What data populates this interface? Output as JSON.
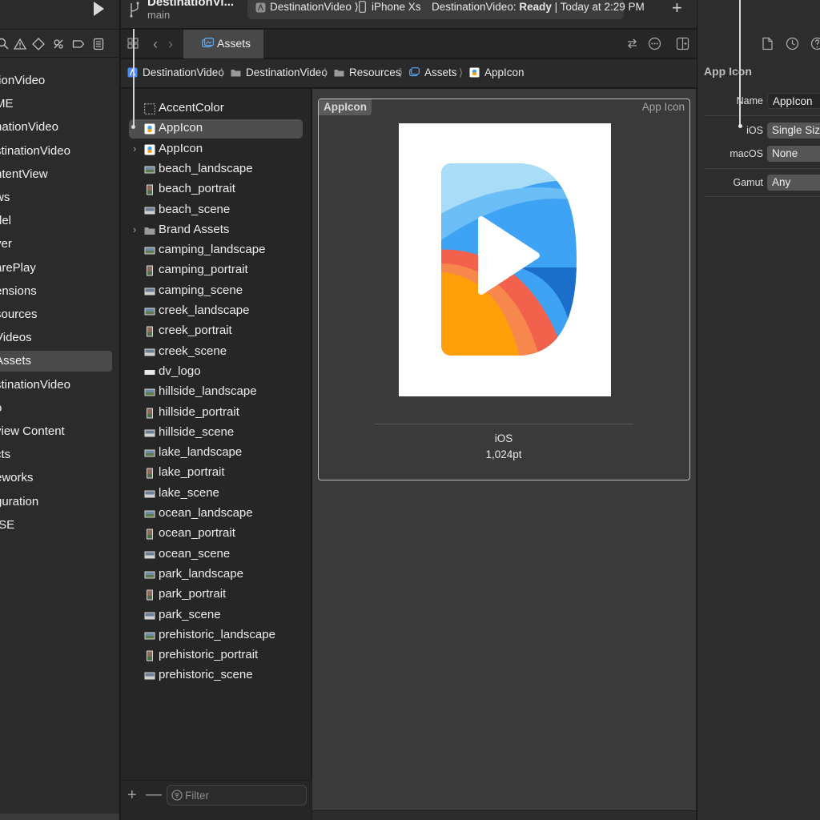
{
  "navigator": {
    "items": [
      {
        "label": "tionVideo",
        "selected": false
      },
      {
        "label": "ME",
        "selected": false
      },
      {
        "label": "nationVideo",
        "selected": false
      },
      {
        "label": "stinationVideo",
        "selected": false
      },
      {
        "label": "ntentView",
        "selected": false
      },
      {
        "label": "ws",
        "selected": false
      },
      {
        "label": "del",
        "selected": false
      },
      {
        "label": "yer",
        "selected": false
      },
      {
        "label": "arePlay",
        "selected": false
      },
      {
        "label": "ensions",
        "selected": false
      },
      {
        "label": "sources",
        "selected": false
      },
      {
        "label": "Videos",
        "selected": false
      },
      {
        "label": "Assets",
        "selected": true
      },
      {
        "label": "stinationVideo",
        "selected": false
      },
      {
        "label": "o",
        "selected": false
      },
      {
        "label": "view Content",
        "selected": false
      },
      {
        "label": "cts",
        "selected": false
      },
      {
        "label": "eworks",
        "selected": false
      },
      {
        "label": "guration",
        "selected": false
      },
      {
        "label": "ISE",
        "selected": false
      }
    ]
  },
  "topbar": {
    "project_name": "DestinationVi...",
    "branch": "main",
    "scheme_target": "DestinationVideo ⟩",
    "device": "iPhone Xs",
    "status_prefix": "DestinationVideo:",
    "status_state": "Ready",
    "status_suffix": "| Today at 2:29 PM",
    "add_label": "+"
  },
  "tabbar": {
    "tab_label": "Assets"
  },
  "pathbar": {
    "crumbs": [
      "DestinationVideo",
      "DestinationVideo",
      "Resources",
      "Assets",
      "AppIcon"
    ],
    "separator": "⟩"
  },
  "assetlist": {
    "items": [
      {
        "label": "AccentColor",
        "icon": "color-set-icon",
        "expandable": false,
        "selected": false
      },
      {
        "label": "AppIcon",
        "icon": "app-icon-set-icon",
        "expandable": false,
        "selected": true
      },
      {
        "label": "AppIcon",
        "icon": "app-icon-set-icon",
        "expandable": true,
        "selected": false
      },
      {
        "label": "beach_landscape",
        "icon": "image-landscape-icon",
        "expandable": false,
        "selected": false
      },
      {
        "label": "beach_portrait",
        "icon": "image-portrait-icon",
        "expandable": false,
        "selected": false
      },
      {
        "label": "beach_scene",
        "icon": "image-scene-icon",
        "expandable": false,
        "selected": false
      },
      {
        "label": "Brand Assets",
        "icon": "folder-icon",
        "expandable": true,
        "selected": false
      },
      {
        "label": "camping_landscape",
        "icon": "image-landscape-icon",
        "expandable": false,
        "selected": false
      },
      {
        "label": "camping_portrait",
        "icon": "image-portrait-icon",
        "expandable": false,
        "selected": false
      },
      {
        "label": "camping_scene",
        "icon": "image-scene-icon",
        "expandable": false,
        "selected": false
      },
      {
        "label": "creek_landscape",
        "icon": "image-landscape-icon",
        "expandable": false,
        "selected": false
      },
      {
        "label": "creek_portrait",
        "icon": "image-portrait-icon",
        "expandable": false,
        "selected": false
      },
      {
        "label": "creek_scene",
        "icon": "image-scene-icon",
        "expandable": false,
        "selected": false
      },
      {
        "label": "dv_logo",
        "icon": "image-logo-icon",
        "expandable": false,
        "selected": false
      },
      {
        "label": "hillside_landscape",
        "icon": "image-landscape-icon",
        "expandable": false,
        "selected": false
      },
      {
        "label": "hillside_portrait",
        "icon": "image-portrait-icon",
        "expandable": false,
        "selected": false
      },
      {
        "label": "hillside_scene",
        "icon": "image-scene-icon",
        "expandable": false,
        "selected": false
      },
      {
        "label": "lake_landscape",
        "icon": "image-landscape-icon",
        "expandable": false,
        "selected": false
      },
      {
        "label": "lake_portrait",
        "icon": "image-portrait-icon",
        "expandable": false,
        "selected": false
      },
      {
        "label": "lake_scene",
        "icon": "image-scene-icon",
        "expandable": false,
        "selected": false
      },
      {
        "label": "ocean_landscape",
        "icon": "image-landscape-icon",
        "expandable": false,
        "selected": false
      },
      {
        "label": "ocean_portrait",
        "icon": "image-portrait-icon",
        "expandable": false,
        "selected": false
      },
      {
        "label": "ocean_scene",
        "icon": "image-scene-icon",
        "expandable": false,
        "selected": false
      },
      {
        "label": "park_landscape",
        "icon": "image-landscape-icon",
        "expandable": false,
        "selected": false
      },
      {
        "label": "park_portrait",
        "icon": "image-portrait-icon",
        "expandable": false,
        "selected": false
      },
      {
        "label": "park_scene",
        "icon": "image-scene-icon",
        "expandable": false,
        "selected": false
      },
      {
        "label": "prehistoric_landscape",
        "icon": "image-landscape-icon",
        "expandable": false,
        "selected": false
      },
      {
        "label": "prehistoric_portrait",
        "icon": "image-portrait-icon",
        "expandable": false,
        "selected": false
      },
      {
        "label": "prehistoric_scene",
        "icon": "image-scene-icon",
        "expandable": false,
        "selected": false
      }
    ],
    "filter_placeholder": "Filter",
    "add_label": "+",
    "remove_label": "—"
  },
  "editor": {
    "iconset_name": "AppIcon",
    "iconset_kind": "App Icon",
    "slot_platform": "iOS",
    "slot_size": "1,024pt"
  },
  "inspector": {
    "title": "App Icon",
    "name_label": "Name",
    "name_value": "AppIcon",
    "ios_label": "iOS",
    "ios_value": "Single Size",
    "macos_label": "macOS",
    "macos_value": "None",
    "gamut_label": "Gamut",
    "gamut_value": "Any"
  },
  "colors": {
    "accent": "#4a8cf7",
    "selection": "#4e4e4e",
    "icon_blue": "#3ea3f5",
    "icon_light_blue": "#a9dcf7",
    "icon_orange": "#ffa00a",
    "icon_red": "#f2614b"
  }
}
